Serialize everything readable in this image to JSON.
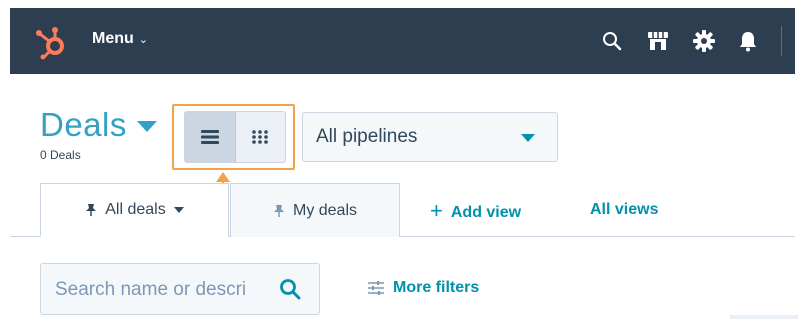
{
  "topbar": {
    "menu_label": "Menu",
    "icons": [
      "search-icon",
      "marketplace-icon",
      "settings-icon",
      "notifications-icon"
    ],
    "bg_color": "#2d3e50"
  },
  "header": {
    "title": "Deals",
    "count": "0 Deals"
  },
  "view_toggle": {
    "active": "list",
    "options": [
      "list-view-icon",
      "board-view-icon"
    ]
  },
  "pipeline": {
    "selected": "All pipelines"
  },
  "tabs": {
    "all_deals": "All deals",
    "my_deals": "My deals",
    "add_view": "Add view",
    "all_views": "All views"
  },
  "search": {
    "placeholder": "Search name or descri"
  },
  "filters": {
    "more_filters": "More filters"
  },
  "colors": {
    "accent": "#0091ae",
    "title": "#33a1c4",
    "highlight": "#f2a248",
    "logo": "#ff7a59"
  }
}
